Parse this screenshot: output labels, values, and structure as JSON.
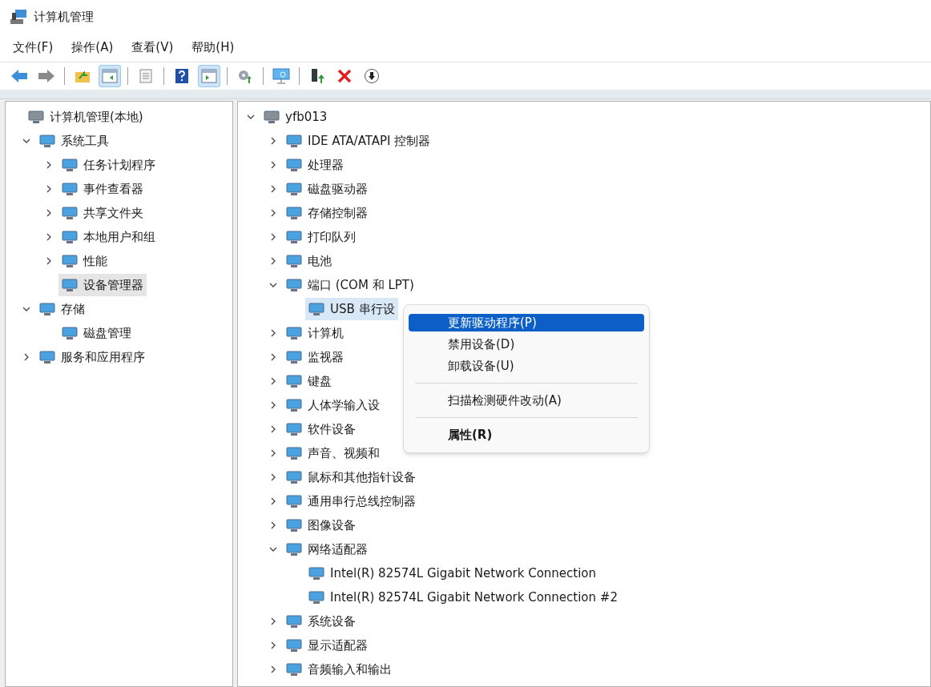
{
  "window": {
    "title": "计算机管理"
  },
  "menu_bar": [
    "文件(F)",
    "操作(A)",
    "查看(V)",
    "帮助(H)"
  ],
  "toolbar": [
    {
      "kind": "back",
      "pressed": false
    },
    {
      "kind": "forward",
      "pressed": false
    },
    {
      "kind": "separator"
    },
    {
      "kind": "up",
      "pressed": false
    },
    {
      "kind": "tree",
      "pressed": true
    },
    {
      "kind": "separator"
    },
    {
      "kind": "properties",
      "pressed": false
    },
    {
      "kind": "separator"
    },
    {
      "kind": "help",
      "pressed": false
    },
    {
      "kind": "pane",
      "pressed": true
    },
    {
      "kind": "separator"
    },
    {
      "kind": "gear",
      "pressed": false
    },
    {
      "kind": "separator"
    },
    {
      "kind": "monitor",
      "pressed": false
    },
    {
      "kind": "separator"
    },
    {
      "kind": "update",
      "pressed": false
    },
    {
      "kind": "delete",
      "pressed": false
    },
    {
      "kind": "download",
      "pressed": false
    }
  ],
  "left_tree": [
    {
      "label": "计算机管理(本地)",
      "selected": false,
      "children": [
        {
          "label": "系统工具",
          "expanded": true,
          "selected": false,
          "children": [
            {
              "label": "任务计划程序",
              "expanded": false,
              "selected": false
            },
            {
              "label": "事件查看器",
              "expanded": false,
              "selected": false
            },
            {
              "label": "共享文件夹",
              "expanded": false,
              "selected": false
            },
            {
              "label": "本地用户和组",
              "expanded": false,
              "selected": false
            },
            {
              "label": "性能",
              "expanded": false,
              "selected": false
            },
            {
              "label": "设备管理器",
              "selected": true
            }
          ]
        },
        {
          "label": "存储",
          "expanded": true,
          "selected": false,
          "children": [
            {
              "label": "磁盘管理",
              "selected": false
            }
          ]
        },
        {
          "label": "服务和应用程序",
          "expanded": false,
          "selected": false
        }
      ]
    }
  ],
  "device_tree": [
    {
      "label": "yfb013",
      "expanded": true,
      "selected": false,
      "children": [
        {
          "label": "IDE ATA/ATAPI 控制器",
          "expanded": false,
          "selected": false
        },
        {
          "label": "处理器",
          "expanded": false,
          "selected": false
        },
        {
          "label": "磁盘驱动器",
          "expanded": false,
          "selected": false
        },
        {
          "label": "存储控制器",
          "expanded": false,
          "selected": false
        },
        {
          "label": "打印队列",
          "expanded": false,
          "selected": false
        },
        {
          "label": "电池",
          "expanded": false,
          "selected": false
        },
        {
          "label": "端口 (COM 和 LPT)",
          "expanded": true,
          "selected": false,
          "children": [
            {
              "label": "USB 串行设",
              "selected": true
            }
          ]
        },
        {
          "label": "计算机",
          "expanded": false,
          "selected": false
        },
        {
          "label": "监视器",
          "expanded": false,
          "selected": false
        },
        {
          "label": "键盘",
          "expanded": false,
          "selected": false
        },
        {
          "label": "人体学输入设",
          "expanded": false,
          "selected": false
        },
        {
          "label": "软件设备",
          "expanded": false,
          "selected": false
        },
        {
          "label": "声音、视频和",
          "expanded": false,
          "selected": false
        },
        {
          "label": "鼠标和其他指针设备",
          "expanded": false,
          "selected": false
        },
        {
          "label": "通用串行总线控制器",
          "expanded": false,
          "selected": false
        },
        {
          "label": "图像设备",
          "expanded": false,
          "selected": false
        },
        {
          "label": "网络适配器",
          "expanded": true,
          "selected": false,
          "children": [
            {
              "label": "Intel(R) 82574L Gigabit Network Connection",
              "selected": false
            },
            {
              "label": "Intel(R) 82574L Gigabit Network Connection #2",
              "selected": false
            }
          ]
        },
        {
          "label": "系统设备",
          "expanded": false,
          "selected": false
        },
        {
          "label": "显示适配器",
          "expanded": false,
          "selected": false
        },
        {
          "label": "音频输入和输出",
          "expanded": false,
          "selected": false
        }
      ]
    }
  ],
  "context_menu": [
    {
      "kind": "item",
      "label": "更新驱动程序(P)",
      "highlighted": true
    },
    {
      "kind": "item",
      "label": "禁用设备(D)",
      "highlighted": false
    },
    {
      "kind": "item",
      "label": "卸载设备(U)",
      "highlighted": false
    },
    {
      "kind": "separator"
    },
    {
      "kind": "item",
      "label": "扫描检测硬件改动(A)",
      "highlighted": false
    },
    {
      "kind": "separator"
    },
    {
      "kind": "default",
      "label": "属性(R)",
      "highlighted": false
    }
  ]
}
